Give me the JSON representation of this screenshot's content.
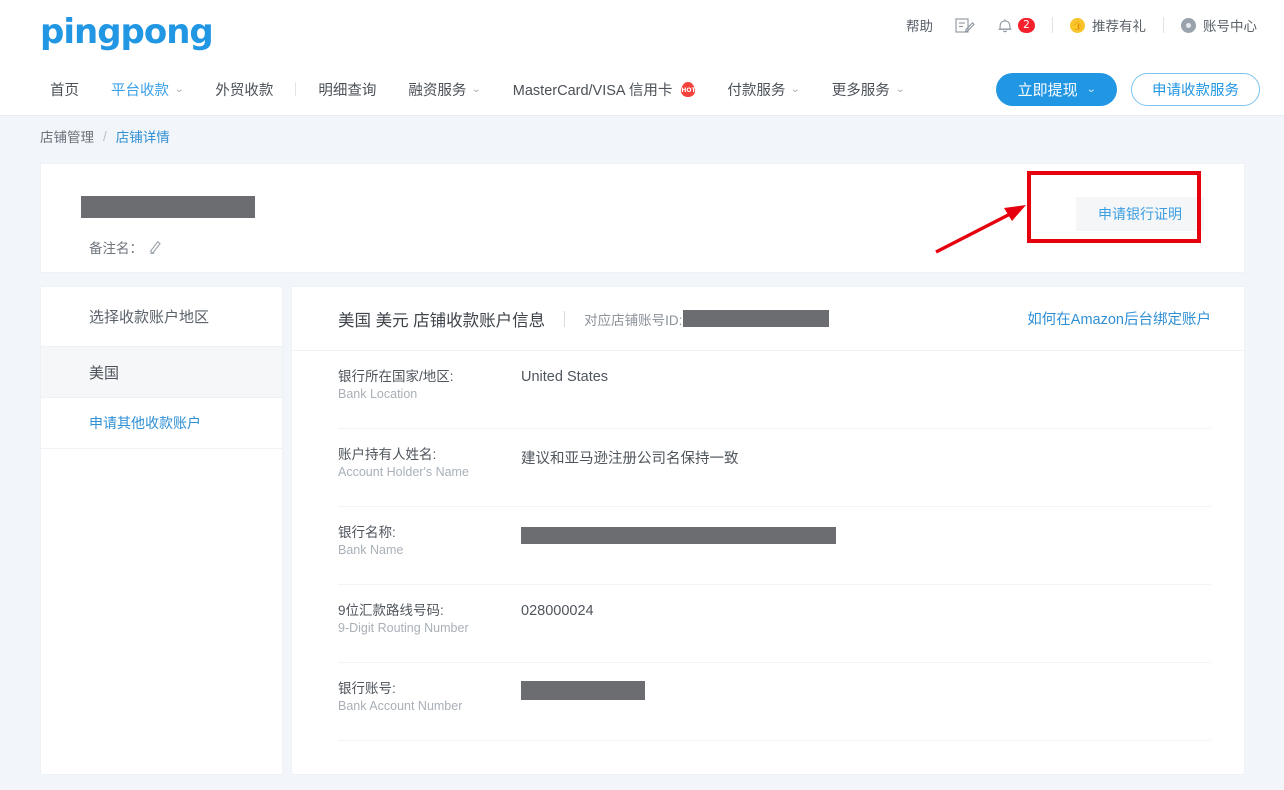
{
  "brand": {
    "logo_text": "pingpong"
  },
  "header_utilities": [
    {
      "label": "帮助",
      "icon": "",
      "name": "help"
    },
    {
      "label": "",
      "icon": "note-edit-icon",
      "name": "feedback"
    },
    {
      "label": "",
      "icon": "bell-icon",
      "badge": "2",
      "name": "notifications"
    },
    {
      "label": "推荐有礼",
      "icon": "thumbs-up-icon",
      "name": "referral"
    },
    {
      "label": "账号中心",
      "icon": "user-circle-icon",
      "name": "account-center"
    }
  ],
  "nav": {
    "items": [
      {
        "label": "首页",
        "has_chevron": false,
        "active": false
      },
      {
        "label": "平台收款",
        "has_chevron": true,
        "active": true
      },
      {
        "label": "外贸收款",
        "has_chevron": false,
        "active": false
      },
      {
        "label": "明细查询",
        "has_chevron": false,
        "active": false
      },
      {
        "label": "融资服务",
        "has_chevron": true,
        "active": false
      },
      {
        "label": "MasterCard/VISA 信用卡",
        "has_chevron": false,
        "active": false,
        "hot_badge": "HOT"
      },
      {
        "label": "付款服务",
        "has_chevron": true,
        "active": false
      },
      {
        "label": "更多服务",
        "has_chevron": true,
        "active": false
      }
    ],
    "withdraw_button": "立即提现",
    "apply_button": "申请收款服务"
  },
  "breadcrumb": {
    "parent": "店铺管理",
    "separator": "/",
    "current": "店铺详情"
  },
  "shop_card": {
    "shop_name_redacted": true,
    "note_label": "备注名：",
    "certificate_button": "申请银行证明"
  },
  "sidebar": {
    "heading": "选择收款账户地区",
    "items": [
      {
        "label": "美国",
        "selected": true
      },
      {
        "label": "申请其他收款账户",
        "selected": false,
        "is_link": true
      }
    ]
  },
  "account_panel": {
    "title": "美国 美元 店铺收款账户信息",
    "shop_id_label": "对应店铺账号ID:",
    "shop_id_redacted": true,
    "help_link": "如何在Amazon后台绑定账户",
    "fields": [
      {
        "label_cn": "银行所在国家/地区:",
        "label_en": "Bank Location",
        "value": "United States",
        "redacted": false
      },
      {
        "label_cn": "账户持有人姓名:",
        "label_en": "Account Holder's Name",
        "value": "建议和亚马逊注册公司名保持一致",
        "redacted": false
      },
      {
        "label_cn": "银行名称:",
        "label_en": "Bank Name",
        "value": "",
        "redacted": true
      },
      {
        "label_cn": "9位汇款路线号码:",
        "label_en": "9-Digit Routing Number",
        "value": "028000024",
        "redacted": false
      },
      {
        "label_cn": "银行账号:",
        "label_en": "Bank Account Number",
        "value": "",
        "redacted": true
      }
    ]
  },
  "annotation": {
    "type": "red-highlight-box-with-arrow",
    "color": "#e6000e",
    "target": "申请银行证明"
  },
  "colors": {
    "brand_blue": "#2196e3",
    "link_blue": "#2f8fd4",
    "page_bg": "#f2f5f9",
    "annotation_red": "#e6000e",
    "badge_red": "#f5222d",
    "redact_gray": "#6b6d70"
  }
}
